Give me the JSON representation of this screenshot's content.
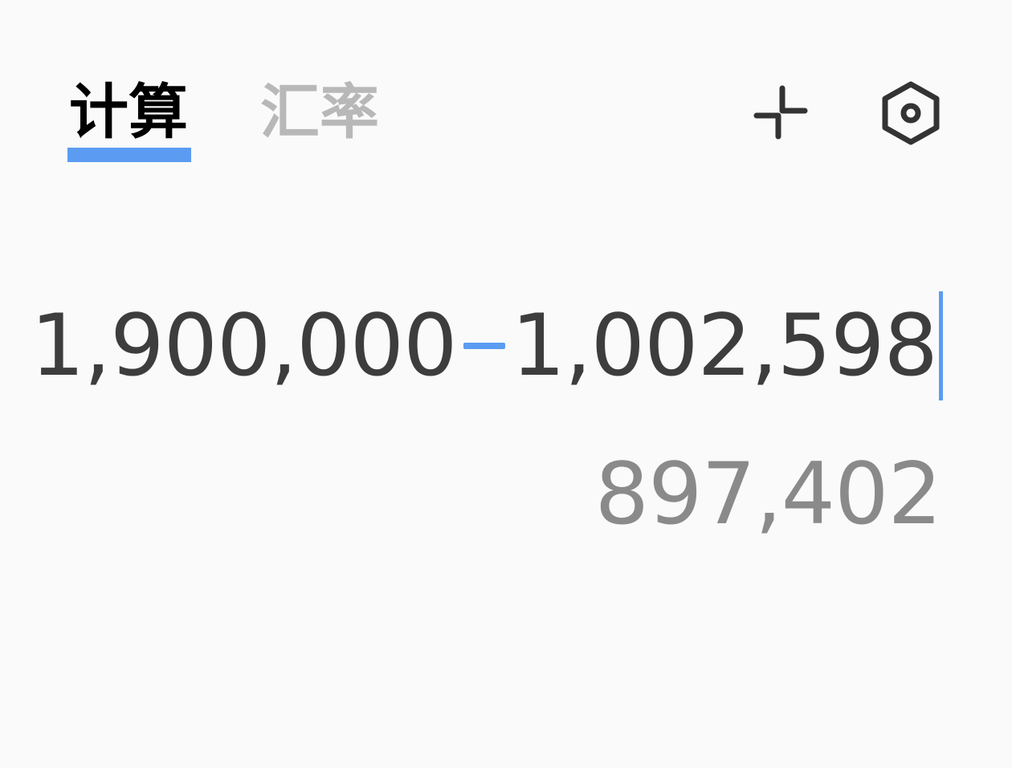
{
  "tabs": [
    {
      "label": "计算",
      "active": true
    },
    {
      "label": "汇率",
      "active": false
    }
  ],
  "toolbar": {
    "collapse_icon": "collapse-icon",
    "settings_icon": "settings-icon"
  },
  "expression": {
    "left_operand": "1,900,000",
    "operator": "−",
    "right_operand": "1,002,598"
  },
  "result": "897,402",
  "colors": {
    "accent": "#5b9cf2",
    "active_tab": "#000000",
    "inactive_tab": "#b8b8b8",
    "expression_text": "#3d3d3d",
    "result_text": "#8a8a8a",
    "background": "#fafafa"
  }
}
